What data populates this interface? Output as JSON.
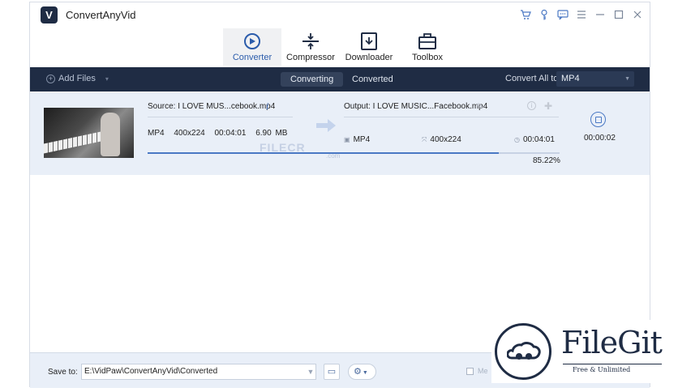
{
  "app": {
    "title": "ConvertAnyVid",
    "logo_letter": "V"
  },
  "window_controls": [
    "cart-icon",
    "key-icon",
    "chat-icon",
    "menu-icon",
    "minimize-icon",
    "maximize-icon",
    "close-icon"
  ],
  "tabs": [
    {
      "label": "Converter",
      "icon": "converter-icon",
      "active": true
    },
    {
      "label": "Compressor",
      "icon": "compressor-icon",
      "active": false
    },
    {
      "label": "Downloader",
      "icon": "downloader-icon",
      "active": false
    },
    {
      "label": "Toolbox",
      "icon": "toolbox-icon",
      "active": false
    }
  ],
  "toolbar": {
    "add_files": "Add Files",
    "segments": [
      "Converting",
      "Converted"
    ],
    "convert_all_label": "Convert All to:",
    "convert_all_value": "MP4"
  },
  "task": {
    "source_name": "Source: I LOVE MUS...cebook.mp4",
    "source_format": "MP4",
    "source_resolution": "400x224",
    "source_duration": "00:04:01",
    "source_size": "6.90 MB",
    "output_name": "Output: I LOVE MUSIC...Facebook.mp4",
    "output_format": "MP4",
    "output_resolution": "400x224",
    "output_duration": "00:04:01",
    "progress_percent": 85.22,
    "progress_label": "85.22%",
    "elapsed": "00:00:02"
  },
  "watermark": {
    "text": "FILECR",
    "suffix": ".com"
  },
  "bottom": {
    "save_to_label": "Save to:",
    "save_path": "E:\\VidPaw\\ConvertAnyVid\\Converted",
    "merge_label": "Me"
  },
  "badge": {
    "title": "FileGit",
    "subtitle": "Free & Unlimited"
  },
  "colors": {
    "accent": "#4a78c4",
    "toolbar_bg": "#1f2c44",
    "row_bg": "#e9eff8"
  }
}
